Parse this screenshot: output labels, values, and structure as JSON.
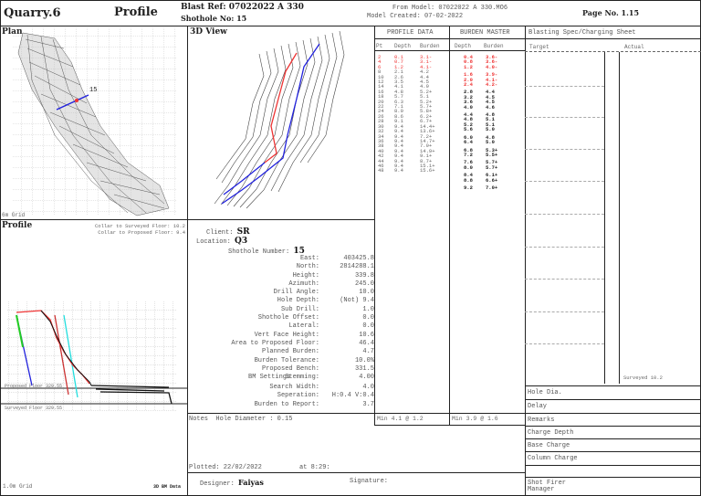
{
  "header": {
    "site": "Quarry.6",
    "report": "Profile",
    "blast_ref_label": "Blast Ref:",
    "blast_ref": "07022022 A 330",
    "shothole_label": "Shothole No:",
    "shothole_no": "15",
    "from_model": "From Model: 07022022 A 330.MO6",
    "model_created": "Model Created: 07-02-2022",
    "page_label": "Page No.",
    "page_no": "1.15"
  },
  "plan": {
    "title": "Plan",
    "hole_label": "15",
    "grid_label": "6m Grid"
  },
  "view3d": {
    "title": "3D View"
  },
  "profile": {
    "title": "Profile",
    "collar_surveyed": "Collar to Surveyed Floor: 10.2",
    "collar_proposed": "Collar to Proposed Floor: 9.4",
    "proposed_floor": "Proposed Floor 329.55",
    "surveyed_floor": "Surveyed Floor 329.55",
    "grid_label": "1.0m Grid",
    "bm_label": "3D BM Data"
  },
  "profile_data": {
    "title": "PROFILE DATA",
    "headers": [
      "Pt",
      "Depth",
      "Burden"
    ],
    "rows": [
      [
        "2",
        "0.1",
        "3.1-"
      ],
      [
        "4",
        "0.7",
        "3.1-"
      ],
      [
        "6",
        "1.2",
        "4.1-"
      ],
      [
        "8",
        "2.1",
        "4.2"
      ],
      [
        "10",
        "2.6",
        "4.4"
      ],
      [
        "12",
        "3.5",
        "4.5"
      ],
      [
        "14",
        "4.1",
        "4.9"
      ],
      [
        "16",
        "4.8",
        "5.2+"
      ],
      [
        "18",
        "5.7",
        "5.1"
      ],
      [
        "20",
        "6.3",
        "5.2+"
      ],
      [
        "22",
        "7.1",
        "5.7+"
      ],
      [
        "24",
        "8.0",
        "5.8+"
      ],
      [
        "26",
        "8.6",
        "6.2+"
      ],
      [
        "28",
        "9.1",
        "6.7+"
      ],
      [
        "30",
        "9.4",
        "14.4+"
      ],
      [
        "32",
        "9.4",
        "13.6+"
      ],
      [
        "34",
        "9.4",
        "7.2+"
      ],
      [
        "36",
        "9.4",
        "14.7+"
      ],
      [
        "38",
        "9.4",
        "7.9+"
      ],
      [
        "40",
        "9.4",
        "14.9+"
      ],
      [
        "42",
        "9.4",
        "9.1+"
      ],
      [
        "44",
        "9.4",
        "8.7+"
      ],
      [
        "46",
        "9.4",
        "15.1+"
      ],
      [
        "48",
        "9.4",
        "15.6+"
      ]
    ],
    "min": "Min 4.1 @ 1.2"
  },
  "burden_master": {
    "title": "BURDEN MASTER",
    "headers": [
      "Depth",
      "Burden"
    ],
    "rows": [
      [
        "0.4",
        "3.6-"
      ],
      [
        "0.8",
        "3.6-"
      ],
      [
        "1.2",
        "4.0-"
      ],
      [
        "1.6",
        "3.9-"
      ],
      [
        "2.0",
        "4.1-"
      ],
      [
        "2.4",
        "4.2-"
      ],
      [
        "2.8",
        "4.4"
      ],
      [
        "3.2",
        "4.5"
      ],
      [
        "3.6",
        "4.5"
      ],
      [
        "4.0",
        "4.6"
      ],
      [
        "4.4",
        "4.8"
      ],
      [
        "4.8",
        "5.1"
      ],
      [
        "5.2",
        "5.1"
      ],
      [
        "5.6",
        "5.0"
      ],
      [
        "6.0",
        "4.8"
      ],
      [
        "6.4",
        "5.0"
      ],
      [
        "6.8",
        "5.3+"
      ],
      [
        "7.2",
        "5.5+"
      ],
      [
        "7.6",
        "5.7+"
      ],
      [
        "8.0",
        "5.7+"
      ],
      [
        "8.4",
        "6.1+"
      ],
      [
        "8.8",
        "6.6+"
      ],
      [
        "9.2",
        "7.0+"
      ]
    ],
    "min": "Min 3.9 @ 1.6"
  },
  "spec": {
    "title": "Blasting Spec/Charging Sheet",
    "target": "Target",
    "actual": "Actual",
    "surveyed": "Surveyed 10.2",
    "rows": [
      "Hole Dia.",
      "Delay",
      "Remarks",
      "Charge Depth",
      "Base Charge",
      "Column Charge",
      "",
      "Shot Firer Manager"
    ]
  },
  "info": {
    "client_label": "Client:",
    "client": "SR",
    "location_label": "Location:",
    "location": "Q3",
    "shothole_label": "Shothole Number:",
    "shothole": "15",
    "fields": [
      [
        "East:",
        "403425.8"
      ],
      [
        "North:",
        "2814288.1"
      ],
      [
        "Height:",
        "339.8"
      ],
      [
        "Azimuth:",
        "245.0"
      ],
      [
        "Drill Angle:",
        "10.0"
      ],
      [
        "Hole Depth:",
        "(Not) 9.4"
      ],
      [
        "Sub Drill:",
        "1.0"
      ],
      [
        "Shothole Offset:",
        "0.0"
      ],
      [
        "Lateral:",
        "0.0"
      ],
      [
        "Vert Face Height:",
        "10.6"
      ],
      [
        "Area to Proposed Floor:",
        "46.4"
      ],
      [
        "Planned Burden:",
        "4.7"
      ],
      [
        "Burden Tolerance:",
        "10.0%"
      ],
      [
        "Proposed Bench:",
        "331.5"
      ],
      [
        "Stemming:",
        "4.00"
      ]
    ],
    "bm_title": "BM Settings",
    "bm_fields": [
      [
        "Search Width:",
        "4.0"
      ],
      [
        "Seperation:",
        "H:0.4 V:0.4"
      ],
      [
        "Burden to Report:",
        "3.7"
      ]
    ]
  },
  "notes": {
    "label": "Notes",
    "text": "Hole Diameter : 0.15",
    "plotted": "Plotted: 22/02/2022",
    "at": "at 8:29:"
  },
  "footer": {
    "designer_label": "Designer:",
    "designer": "Faiyas",
    "signature_label": "Signature:"
  },
  "colors": {
    "red": "#e33333",
    "blue": "#2233dd",
    "green": "#22cc22",
    "cyan": "#22dddd"
  }
}
